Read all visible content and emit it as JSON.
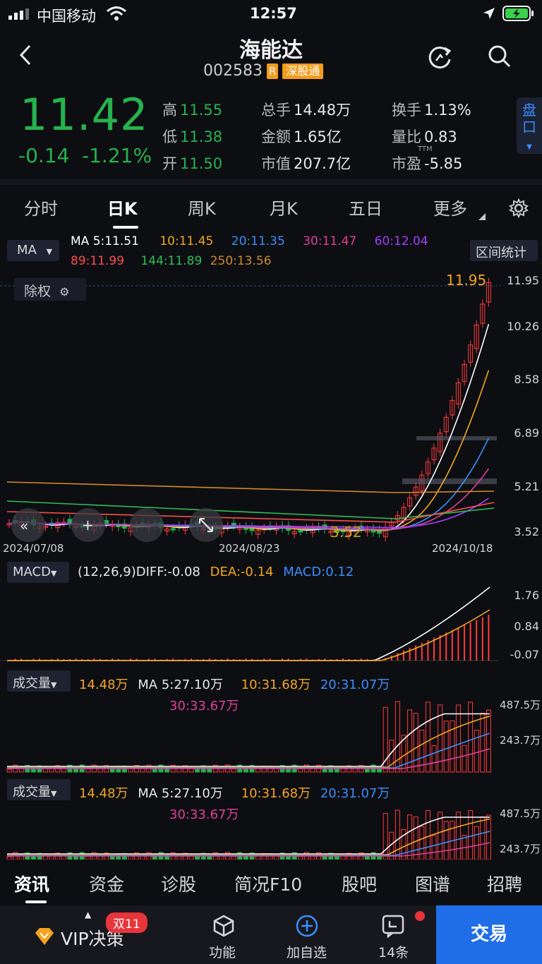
{
  "status": {
    "carrier": "中国移动",
    "time": "12:57"
  },
  "stock": {
    "name": "海能达",
    "code": "002583",
    "badge_r": "R",
    "badge_market": "深股通"
  },
  "quote": {
    "price": "11.42",
    "change": "-0.14",
    "change_pct": "-1.21%",
    "high_label": "高",
    "high": "11.55",
    "low_label": "低",
    "low": "11.38",
    "open_label": "开",
    "open": "11.50",
    "volume_label": "总手",
    "volume": "14.48万",
    "amount_label": "金额",
    "amount": "1.65亿",
    "mktcap_label": "市值",
    "mktcap": "207.7亿",
    "turnover_label": "换手",
    "turnover": "1.13%",
    "volratio_label": "量比",
    "volratio": "0.83",
    "pe_label": "市盈",
    "pe_ttm": "TTM",
    "pe": "-5.85",
    "pankou": "盘口"
  },
  "tabs": [
    "分时",
    "日K",
    "周K",
    "月K",
    "五日",
    "更多"
  ],
  "active_tab": "日K",
  "ma": {
    "selector": "MA",
    "ma5": "MA 5:11.51",
    "ma10": "10:11.45",
    "ma20": "20:11.35",
    "ma30": "30:11.47",
    "ma60": "60:12.04",
    "ma89": "89:11.99",
    "ma144": "144:11.89",
    "ma250": "250:13.56",
    "range_stats": "区间统计",
    "exright": "除权",
    "high_mark": "11.95",
    "low_mark": "3.52"
  },
  "colors": {
    "ma5": "#ffffff",
    "ma10": "#f5a623",
    "ma20": "#3b8fff",
    "ma30": "#e0409a",
    "ma60": "#a040ff",
    "ma89": "#ff4d4d",
    "ma144": "#2fbf5a",
    "ma250": "#d08a2a",
    "up": "#ff3b3b",
    "down": "#22b24c"
  },
  "price_axis": [
    "11.95",
    "10.26",
    "8.58",
    "6.89",
    "5.21",
    "3.52"
  ],
  "dates": [
    "2024/07/08",
    "2024/08/23",
    "2024/10/18"
  ],
  "macd": {
    "selector": "MACD",
    "params": "(12,26,9)",
    "diff": "DIFF:-0.08",
    "dea": "DEA:-0.14",
    "macd": "MACD:0.12",
    "axis": [
      "1.76",
      "0.84",
      "-0.07"
    ]
  },
  "volume1": {
    "selector": "成交量",
    "vol": "14.48万",
    "ma5": "MA 5:27.10万",
    "ma10": "10:31.68万",
    "ma20": "20:31.07万",
    "ma30": "30:33.67万",
    "axis": [
      "487.5万",
      "243.7万"
    ]
  },
  "volume2": {
    "selector": "成交量",
    "vol": "14.48万",
    "ma5": "MA 5:27.10万",
    "ma10": "10:31.68万",
    "ma20": "20:31.07万",
    "ma30": "30:33.67万",
    "axis": [
      "487.5万",
      "243.7万"
    ]
  },
  "bottom_tabs": [
    "资讯",
    "资金",
    "诊股",
    "简况F10",
    "股吧",
    "图谱",
    "招聘"
  ],
  "toolbar": {
    "vip": "VIP决策",
    "promo": "双11",
    "func": "功能",
    "add": "加自选",
    "news": "14条",
    "trade": "交易"
  },
  "chart_data": {
    "type": "candlestick",
    "candles": [
      {
        "date": "2024/07/08",
        "close": 3.9
      },
      {
        "date": "2024/08/23",
        "close": 3.6
      },
      {
        "date": "2024/10/18",
        "close": 11.42
      }
    ],
    "ylim": [
      3.52,
      11.95
    ],
    "high_marker": 11.95,
    "low_marker": 3.52
  }
}
